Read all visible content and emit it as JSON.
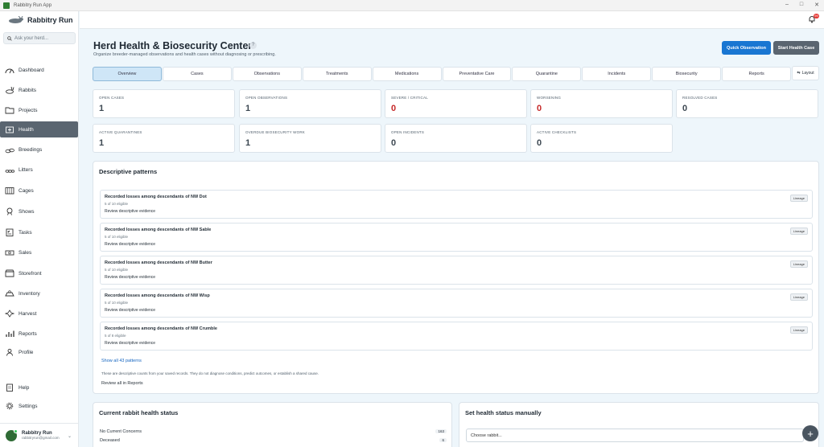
{
  "window": {
    "title": "Rabbitry Run App"
  },
  "brand": {
    "name": "Rabbitry Run"
  },
  "search": {
    "placeholder": "Ask your herd..."
  },
  "sidebar": {
    "items": [
      {
        "label": "Dashboard",
        "icon": "dashboard-icon"
      },
      {
        "label": "Rabbits",
        "icon": "rabbit-icon"
      },
      {
        "label": "Projects",
        "icon": "folder-icon"
      },
      {
        "label": "Health",
        "icon": "health-icon"
      },
      {
        "label": "Breedings",
        "icon": "breeding-icon"
      },
      {
        "label": "Litters",
        "icon": "litter-icon"
      },
      {
        "label": "Cages",
        "icon": "cage-icon"
      },
      {
        "label": "Shows",
        "icon": "ribbon-icon"
      },
      {
        "label": "Tasks",
        "icon": "tasks-icon"
      },
      {
        "label": "Sales",
        "icon": "sales-icon"
      },
      {
        "label": "Storefront",
        "icon": "storefront-icon"
      },
      {
        "label": "Inventory",
        "icon": "inventory-icon"
      },
      {
        "label": "Harvest",
        "icon": "harvest-icon"
      },
      {
        "label": "Reports",
        "icon": "reports-icon"
      },
      {
        "label": "Profile",
        "icon": "profile-icon"
      }
    ],
    "footer": [
      {
        "label": "Help",
        "icon": "help-icon"
      },
      {
        "label": "Settings",
        "icon": "gear-icon"
      }
    ],
    "active": "Health"
  },
  "user": {
    "name": "Rabbitry Run",
    "email": "rabbitryrun@gmail.com"
  },
  "notifications": {
    "badge": "99"
  },
  "header": {
    "title": "Herd Health & Biosecurity Center",
    "subtitle": "Organize breeder-managed observations and health cases without diagnosing or prescribing.",
    "primary_button": "Quick Observation",
    "secondary_button": "Start Health Case"
  },
  "tabs": [
    "Overview",
    "Cases",
    "Observations",
    "Treatments",
    "Medications",
    "Preventative Care",
    "Quarantine",
    "Incidents",
    "Biosecurity",
    "Reports"
  ],
  "layout_button": "Layout",
  "stats": [
    {
      "label": "OPEN CASES",
      "value": "1",
      "alert": false
    },
    {
      "label": "OPEN OBSERVATIONS",
      "value": "1",
      "alert": false
    },
    {
      "label": "SEVERE / CRITICAL",
      "value": "0",
      "alert": true
    },
    {
      "label": "WORSENING",
      "value": "0",
      "alert": true
    },
    {
      "label": "RESOLVED CASES",
      "value": "0",
      "alert": false
    },
    {
      "label": "ACTIVE QUARANTINES",
      "value": "1",
      "alert": false
    },
    {
      "label": "OVERDUE BIOSECURITY WORK",
      "value": "1",
      "alert": false
    },
    {
      "label": "OPEN INCIDENTS",
      "value": "0",
      "alert": false
    },
    {
      "label": "ACTIVE CHECKLISTS",
      "value": "0",
      "alert": false
    }
  ],
  "patterns": {
    "title": "Descriptive patterns",
    "items": [
      {
        "title": "Recorded losses among descendants of NW Dot",
        "sub": "5 of 10 eligible",
        "link": "Review descriptive evidence",
        "tag": "Lineage"
      },
      {
        "title": "Recorded losses among descendants of NW Sable",
        "sub": "5 of 10 eligible",
        "link": "Review descriptive evidence",
        "tag": "Lineage"
      },
      {
        "title": "Recorded losses among descendants of NW Butter",
        "sub": "5 of 10 eligible",
        "link": "Review descriptive evidence",
        "tag": "Lineage"
      },
      {
        "title": "Recorded losses among descendants of NW Wisp",
        "sub": "5 of 10 eligible",
        "link": "Review descriptive evidence",
        "tag": "Lineage"
      },
      {
        "title": "Recorded losses among descendants of NW Crumble",
        "sub": "5 of 8 eligible",
        "link": "Review descriptive evidence",
        "tag": "Lineage"
      }
    ],
    "show_all": "Show all 43 patterns",
    "disclaimer": "These are descriptive counts from your saved records. They do not diagnose conditions, predict outcomes, or establish a shared cause.",
    "reports_link": "Review all in Reports"
  },
  "health_status": {
    "title": "Current rabbit health status",
    "rows": [
      {
        "label": "No Current Concerns",
        "count": "163"
      },
      {
        "label": "Deceased",
        "count": "6"
      }
    ]
  },
  "manual_status": {
    "title": "Set health status manually",
    "select_placeholder": "Choose rabbit..."
  },
  "fab": "+"
}
